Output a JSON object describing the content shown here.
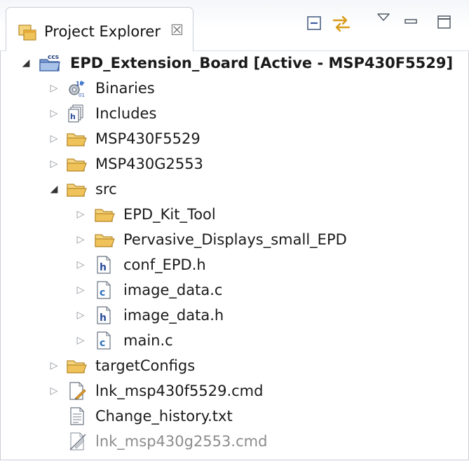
{
  "panel": {
    "title": "Project Explorer",
    "close_glyph": "☒",
    "toolbar": {
      "collapse_all": "collapse-all-icon",
      "link_with_editor": "link-with-editor-icon",
      "view_menu": "view-menu-icon",
      "minimize": "minimize-icon",
      "maximize": "maximize-icon"
    }
  },
  "colors": {
    "folder": "#f0c35a",
    "folder_stroke": "#b8892a",
    "header_file_letter": "#2a4d9b",
    "source_file_letter": "#2a6fbf",
    "selection_border": "#c9ced6"
  },
  "tree": {
    "root": {
      "label": "EPD_Extension_Board  [Active - MSP430F5529]",
      "expanded": true,
      "icon": "ccs-project-icon"
    },
    "items": [
      {
        "label": "Binaries",
        "icon": "binaries-icon",
        "expanded": false
      },
      {
        "label": "Includes",
        "icon": "includes-icon",
        "expanded": false
      },
      {
        "label": "MSP430F5529",
        "icon": "folder-icon",
        "expanded": false
      },
      {
        "label": "MSP430G2553",
        "icon": "folder-icon",
        "expanded": false
      },
      {
        "label": "src",
        "icon": "folder-icon",
        "expanded": true
      },
      {
        "label": "EPD_Kit_Tool",
        "icon": "folder-icon",
        "expanded": false
      },
      {
        "label": "Pervasive_Displays_small_EPD",
        "icon": "folder-icon",
        "expanded": false
      },
      {
        "label": "conf_EPD.h",
        "icon": "header-file-icon",
        "expanded": false
      },
      {
        "label": "image_data.c",
        "icon": "c-file-icon",
        "expanded": false
      },
      {
        "label": "image_data.h",
        "icon": "header-file-icon",
        "expanded": false
      },
      {
        "label": "main.c",
        "icon": "c-file-icon",
        "expanded": false
      },
      {
        "label": "targetConfigs",
        "icon": "folder-icon",
        "expanded": false
      },
      {
        "label": "lnk_msp430f5529.cmd",
        "icon": "linker-cmd-icon",
        "expanded": false
      },
      {
        "label": "Change_history.txt",
        "icon": "text-file-icon"
      },
      {
        "label": "lnk_msp430g2553.cmd",
        "icon": "excluded-cmd-icon",
        "excluded": true
      }
    ]
  }
}
